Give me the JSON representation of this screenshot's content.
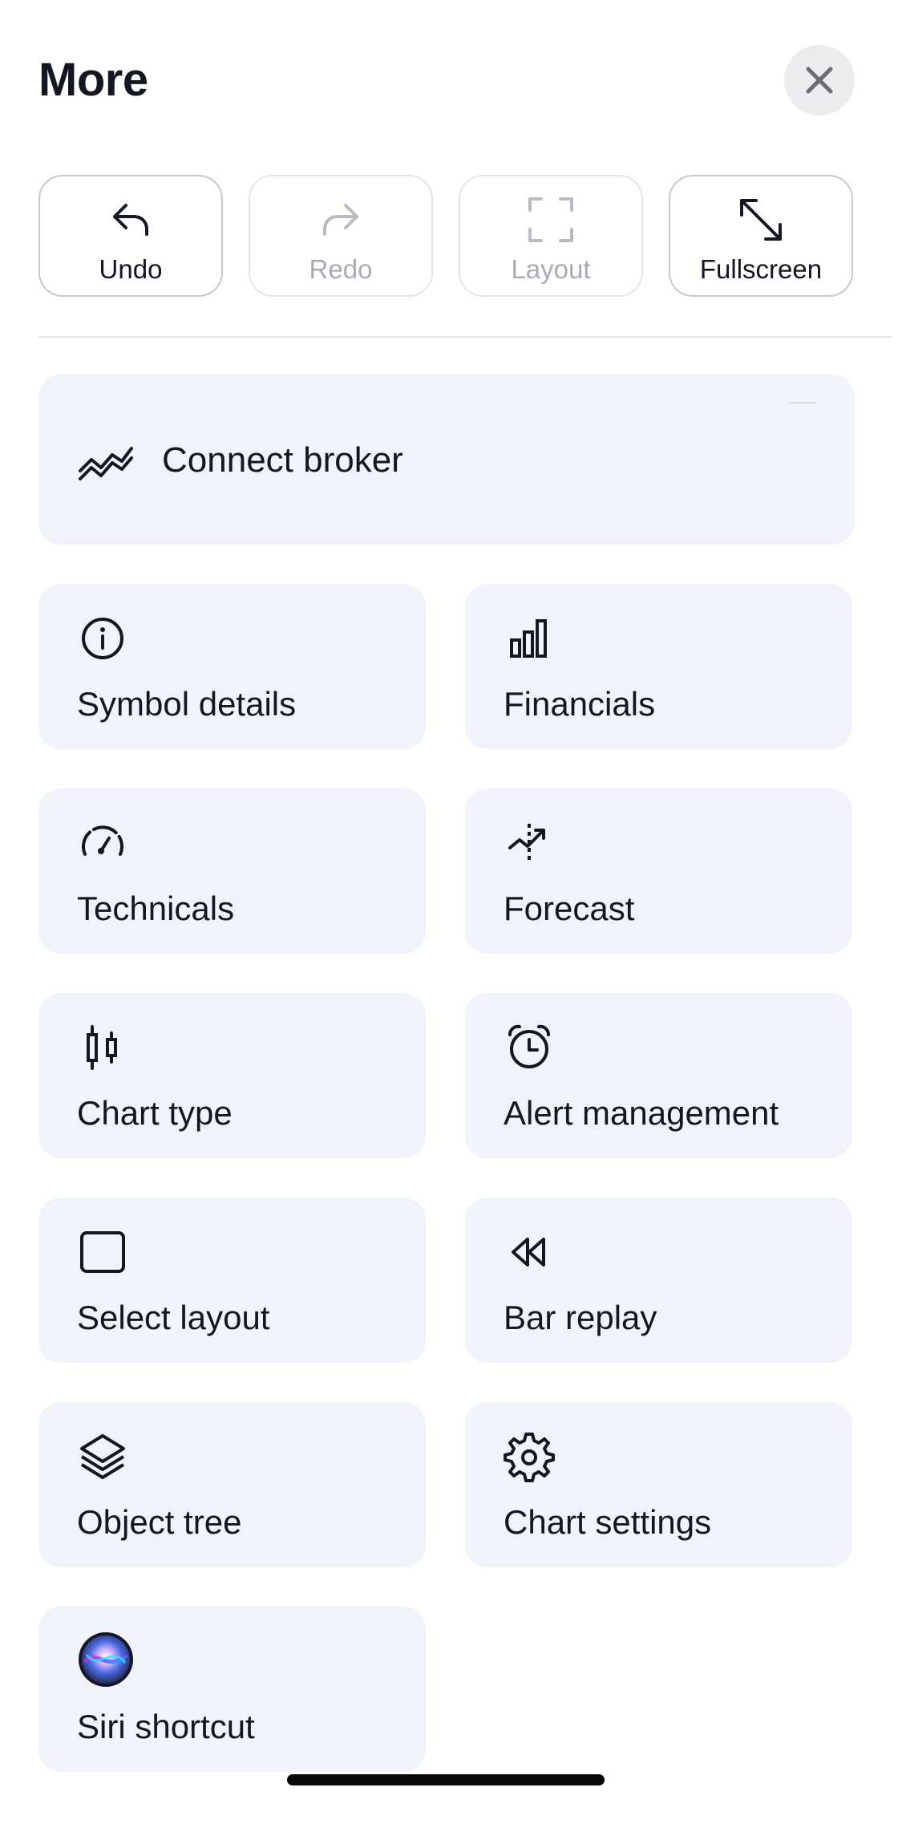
{
  "header": {
    "title": "More",
    "close_icon": "close-icon"
  },
  "toolbar": {
    "undo": {
      "label": "Undo",
      "icon": "undo-icon",
      "enabled": true
    },
    "redo": {
      "label": "Redo",
      "icon": "redo-icon",
      "enabled": false
    },
    "layout": {
      "label": "Layout",
      "icon": "layout-frame-icon",
      "enabled": false
    },
    "fullscreen": {
      "label": "Fullscreen",
      "icon": "fullscreen-icon",
      "enabled": true
    }
  },
  "broker": {
    "label": "Connect broker",
    "icon": "broker-handshake-icon"
  },
  "grid": [
    {
      "label": "Symbol details",
      "icon": "info-icon"
    },
    {
      "label": "Financials",
      "icon": "bar-chart-icon"
    },
    {
      "label": "Technicals",
      "icon": "gauge-icon"
    },
    {
      "label": "Forecast",
      "icon": "forecast-icon"
    },
    {
      "label": "Chart type",
      "icon": "candlestick-icon"
    },
    {
      "label": "Alert management",
      "icon": "alarm-clock-icon"
    },
    {
      "label": "Select layout",
      "icon": "square-layout-icon"
    },
    {
      "label": "Bar replay",
      "icon": "rewind-icon"
    },
    {
      "label": "Object tree",
      "icon": "layers-icon"
    },
    {
      "label": "Chart settings",
      "icon": "gear-icon"
    },
    {
      "label": "Siri shortcut",
      "icon": "siri-icon"
    }
  ],
  "colors": {
    "card_bg": "#f0f3fa",
    "text": "#131722",
    "disabled_text": "#a8abb3",
    "close_bg": "#ececee"
  }
}
